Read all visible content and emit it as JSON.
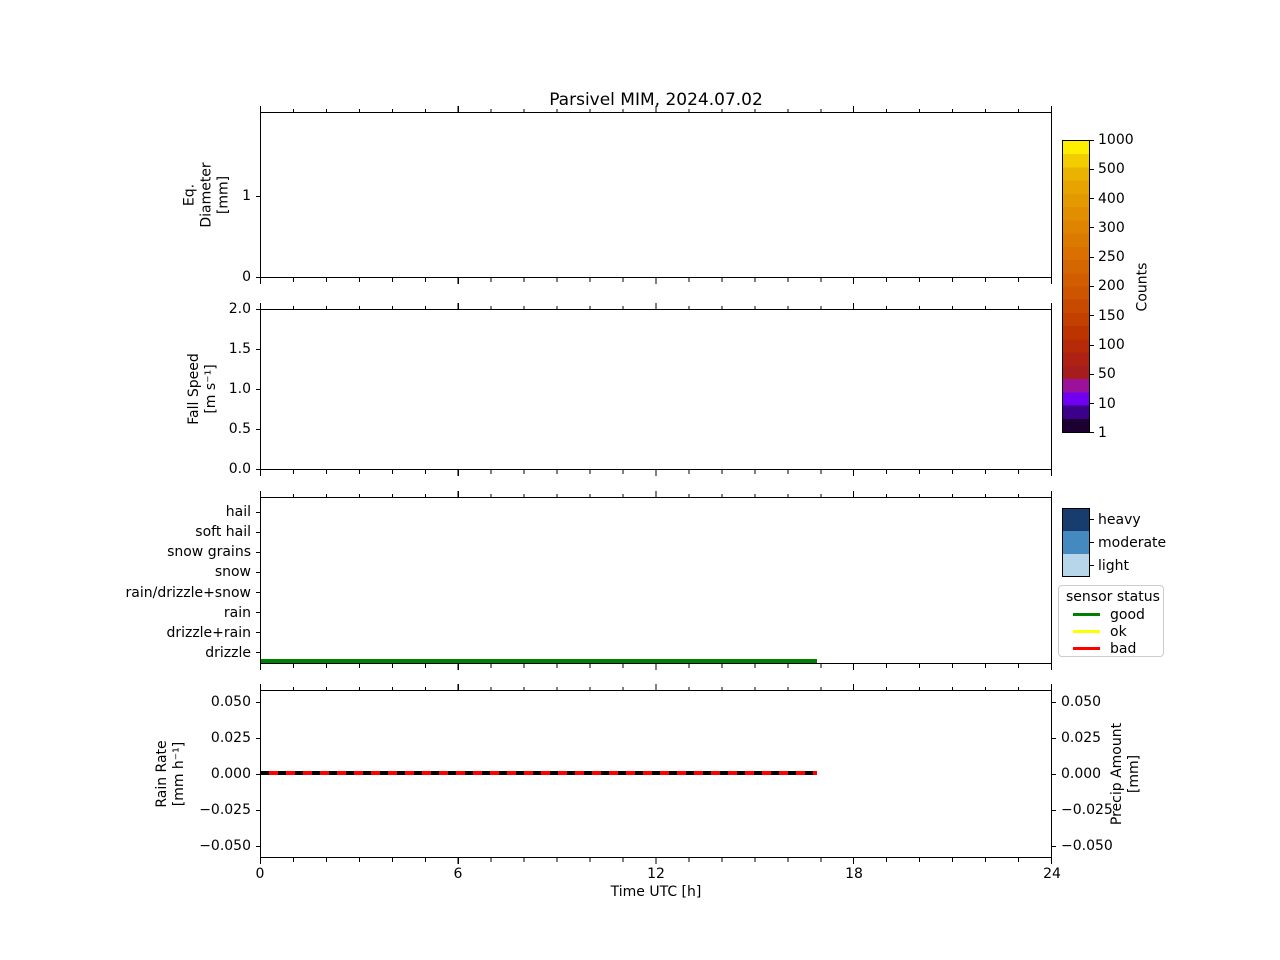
{
  "title": "Parsivel MIM, 2024.07.02",
  "xlabel": "Time UTC [h]",
  "xticks": [
    "0",
    "6",
    "12",
    "18",
    "24"
  ],
  "panel_diameter": {
    "ylabel_text": "Eq.\nDiameter\n[mm]",
    "yticks": [
      "1",
      "0"
    ]
  },
  "panel_fallspeed": {
    "ylabel_text": "Fall Speed\n[m s⁻¹]",
    "yticks": [
      "2.0",
      "1.5",
      "1.0",
      "0.5",
      "0.0"
    ]
  },
  "panel_preciptype": {
    "categories": [
      "hail",
      "soft hail",
      "snow grains",
      "snow",
      "rain/drizzle+snow",
      "rain",
      "drizzle+rain",
      "drizzle"
    ]
  },
  "panel_rainrate": {
    "ylabel_text": "Rain Rate\n[mm h⁻¹]",
    "yticks": [
      "0.050",
      "0.025",
      "0.000",
      "−0.025",
      "−0.050"
    ],
    "ylabel_right_text": "Precip Amount\n[mm]",
    "yticks_right": [
      "0.050",
      "0.025",
      "0.000",
      "−0.025",
      "−0.050"
    ]
  },
  "colorbar": {
    "label": "Counts",
    "tick_labels": [
      "1000",
      "500",
      "400",
      "300",
      "250",
      "200",
      "150",
      "100",
      "50",
      "10",
      "1"
    ],
    "band_colors_top_to_bottom": [
      "#ffee00",
      "#f3cd00",
      "#eab301",
      "#e7a400",
      "#e49900",
      "#e18e00",
      "#df8400",
      "#dc7a00",
      "#d97000",
      "#d56700",
      "#d15d00",
      "#cd5400",
      "#c84a00",
      "#c34000",
      "#bd3400",
      "#b62a07",
      "#ae2113",
      "#a51d1d",
      "#9b119b",
      "#6f00f0",
      "#3c008a",
      "#1c0031"
    ]
  },
  "intensity_legend": {
    "items": [
      {
        "label": "heavy",
        "color": "#163d6e"
      },
      {
        "label": "moderate",
        "color": "#4589c1"
      },
      {
        "label": "light",
        "color": "#b8d6ea"
      }
    ]
  },
  "sensor_legend": {
    "title": "sensor status",
    "items": [
      {
        "label": "good",
        "color": "#008000"
      },
      {
        "label": "ok",
        "color": "#ffff00"
      },
      {
        "label": "bad",
        "color": "#ff0000"
      }
    ]
  },
  "lines": {
    "start_hour": 0,
    "end_hour": 16.9
  },
  "chart_data": [
    {
      "type": "heatmap",
      "panel": "eq-diameter",
      "title": "Parsivel MIM, 2024.07.02",
      "ylabel": "Eq. Diameter [mm]",
      "xlim": [
        0,
        24
      ],
      "ylim": [
        0,
        2.1
      ],
      "yticks": [
        0,
        1
      ],
      "series": [],
      "note": "no counts plotted (empty panel)"
    },
    {
      "type": "heatmap",
      "panel": "fall-speed",
      "ylabel": "Fall Speed [m s⁻¹]",
      "xlim": [
        0,
        24
      ],
      "ylim": [
        0.0,
        2.0
      ],
      "yticks": [
        0.0,
        0.5,
        1.0,
        1.5,
        2.0
      ],
      "series": [],
      "note": "no counts plotted (empty panel)"
    },
    {
      "type": "line",
      "panel": "precip-type",
      "xlim": [
        0,
        24
      ],
      "categories": [
        "hail",
        "soft hail",
        "snow grains",
        "snow",
        "rain/drizzle+snow",
        "rain",
        "drizzle+rain",
        "drizzle"
      ],
      "series": [
        {
          "name": "sensor status good",
          "color": "#008000",
          "x": [
            0,
            16.9
          ],
          "y_constant": "baseline below drizzle"
        }
      ]
    },
    {
      "type": "line",
      "panel": "rain-rate",
      "xlabel": "Time UTC [h]",
      "ylabel": "Rain Rate [mm h⁻¹]",
      "ylabel_right": "Precip Amount [mm]",
      "xlim": [
        0,
        24
      ],
      "ylim": [
        -0.055,
        0.055
      ],
      "yticks": [
        0.05,
        0.025,
        0.0,
        -0.025,
        -0.05
      ],
      "series": [
        {
          "name": "rain rate",
          "color": "#ff0000",
          "style": "solid",
          "x": [
            0,
            16.9
          ],
          "y_constant": 0.0
        },
        {
          "name": "precip amount",
          "color": "#000000",
          "style": "dashed",
          "x": [
            0,
            16.9
          ],
          "y_constant": 0.0
        }
      ]
    }
  ]
}
